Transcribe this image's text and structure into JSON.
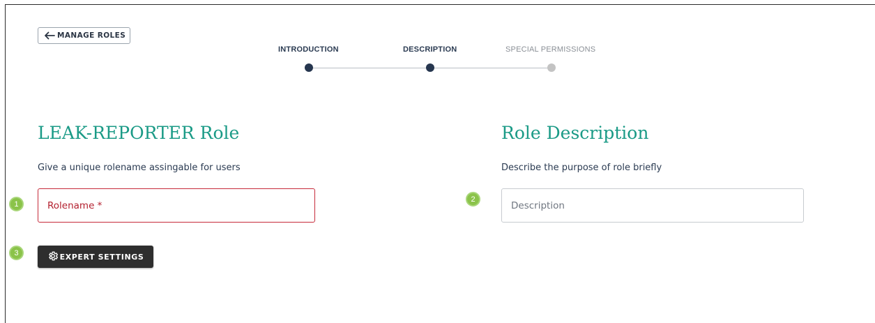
{
  "nav": {
    "back_label": "MANAGE ROLES"
  },
  "stepper": {
    "steps": [
      {
        "label": "INTRODUCTION",
        "state": "completed"
      },
      {
        "label": "DESCRIPTION",
        "state": "active"
      },
      {
        "label": "SPECIAL PERMISSIONS",
        "state": "pending"
      }
    ]
  },
  "left": {
    "title": "LEAK-REPORTER Role",
    "subtitle": "Give a unique rolename assingable for users",
    "rolename_placeholder": "Rolename *",
    "rolename_value": "",
    "expert_label": "EXPERT SETTINGS"
  },
  "right": {
    "title": "Role Description",
    "subtitle": "Describe the purpose of role briefly",
    "description_placeholder": "Description",
    "description_value": ""
  },
  "badges": [
    "1",
    "2",
    "3"
  ],
  "icons": {
    "back": "arrow-left-icon",
    "expert": "gear-icon"
  },
  "colors": {
    "accent_title": "#1a9a86",
    "step_active": "#26364f",
    "step_pending": "#c3c3c3",
    "error": "#c62a3a",
    "badge": "#8bc34a",
    "dark_button": "#2e2e2e"
  }
}
